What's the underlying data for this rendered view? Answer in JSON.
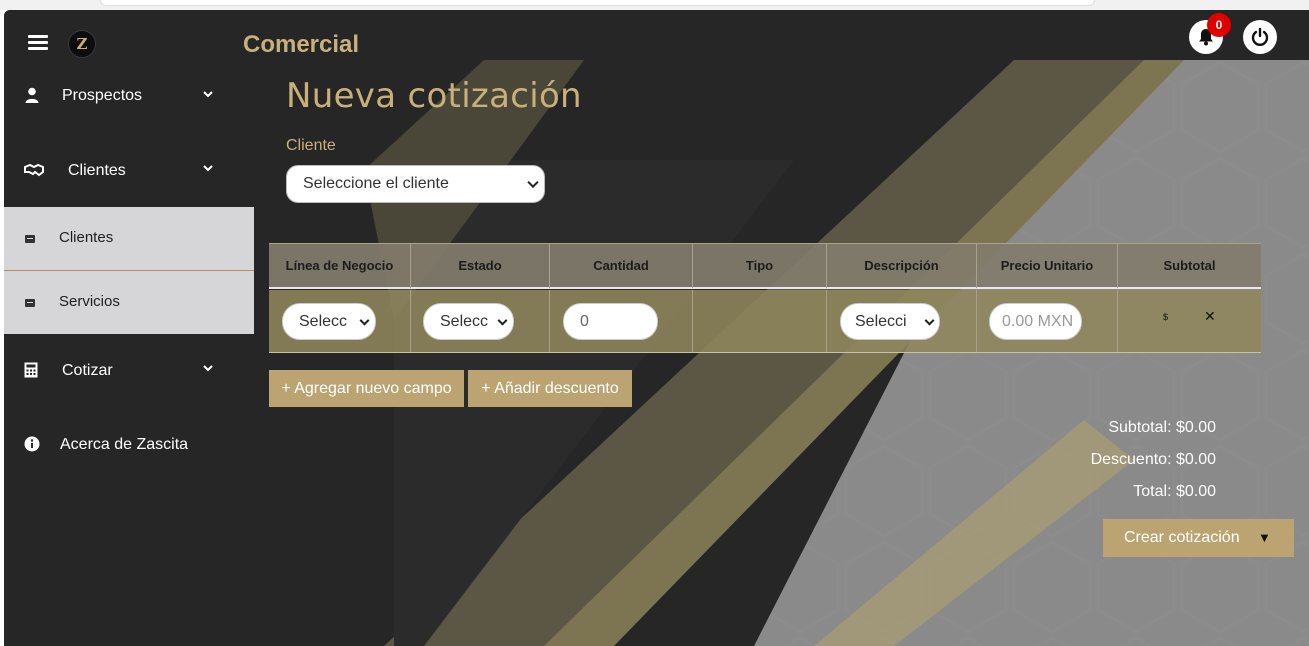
{
  "header": {
    "title": "Comercial",
    "logo_letter": "Z",
    "notifications_count": "0",
    "menu_icon": "hamburger-icon",
    "bell_icon": "bell-icon",
    "power_icon": "power-icon"
  },
  "sidebar": {
    "items": [
      {
        "label": "Prospectos",
        "icon": "user-icon",
        "expandable": true
      },
      {
        "label": "Clientes",
        "icon": "handshake-icon",
        "expandable": true
      },
      {
        "label": "Cotizar",
        "icon": "calculator-icon",
        "expandable": true
      },
      {
        "label": "Acerca de Zascita",
        "icon": "info-icon",
        "expandable": false
      }
    ],
    "sub_items": [
      {
        "label": "Clientes",
        "icon": "id-card-icon"
      },
      {
        "label": "Servicios",
        "icon": "id-card-icon"
      }
    ]
  },
  "main": {
    "title": "Nueva cotización",
    "client_label": "Cliente",
    "client_select_value": "Seleccione el cliente",
    "table": {
      "headers": [
        "Línea de Negocio",
        "Estado",
        "Cantidad",
        "Tipo",
        "Descripción",
        "Precio Unitario",
        "Subtotal"
      ],
      "row": {
        "linea": "Selecc",
        "estado": "Selecc",
        "cantidad": "0",
        "tipo": "",
        "descripcion": "Selecci",
        "precio_placeholder": "0.00 MXN",
        "subtotal": "$",
        "delete": "✕"
      }
    },
    "add_field_label": "+ Agregar nuevo campo",
    "add_discount_label": "+ Añadir descuento",
    "subtotal": "Subtotal: $0.00",
    "discount": "Descuento: $0.00",
    "total": "Total: $0.00",
    "create_label": "Crear cotización",
    "create_caret": "▼"
  },
  "colors": {
    "accent": "#c8b07a",
    "button": "#bba472",
    "background": "#262626",
    "badge": "#e00000"
  }
}
